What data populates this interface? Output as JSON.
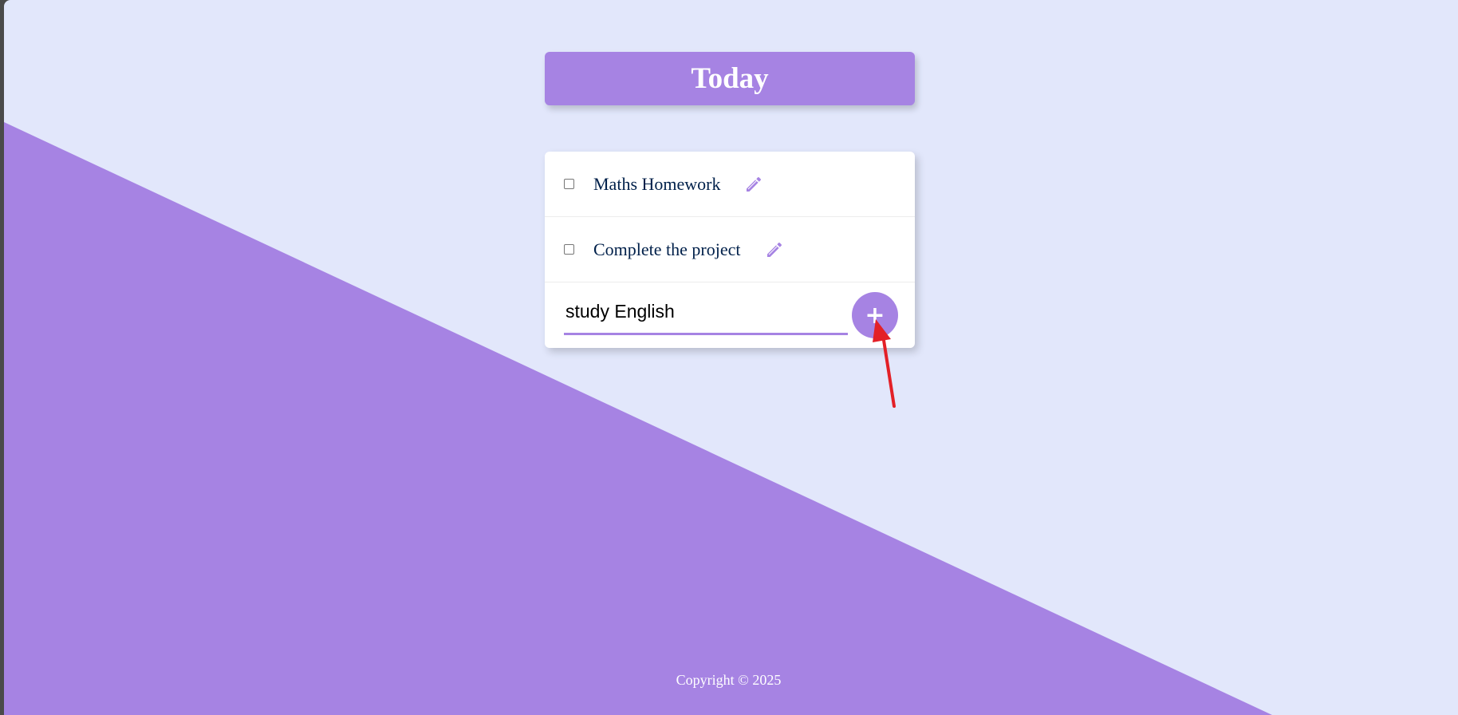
{
  "header": {
    "title": "Today"
  },
  "todo_list": {
    "items": [
      {
        "label": "Maths Homework",
        "checked": false,
        "edit_icon": "pencil-icon"
      },
      {
        "label": "Complete the project",
        "checked": false,
        "edit_icon": "pencil-icon"
      }
    ]
  },
  "new_item_form": {
    "input_value": "study English",
    "add_button_label": "+"
  },
  "footer": {
    "copyright": "Copyright © 2025"
  },
  "annotation": {
    "arrow_color": "#e32027",
    "target": "add-button"
  },
  "colors": {
    "background_light": "#e2e7fb",
    "accent_purple": "#a683e3",
    "text_dark": "#00204a",
    "card_white": "#ffffff"
  }
}
